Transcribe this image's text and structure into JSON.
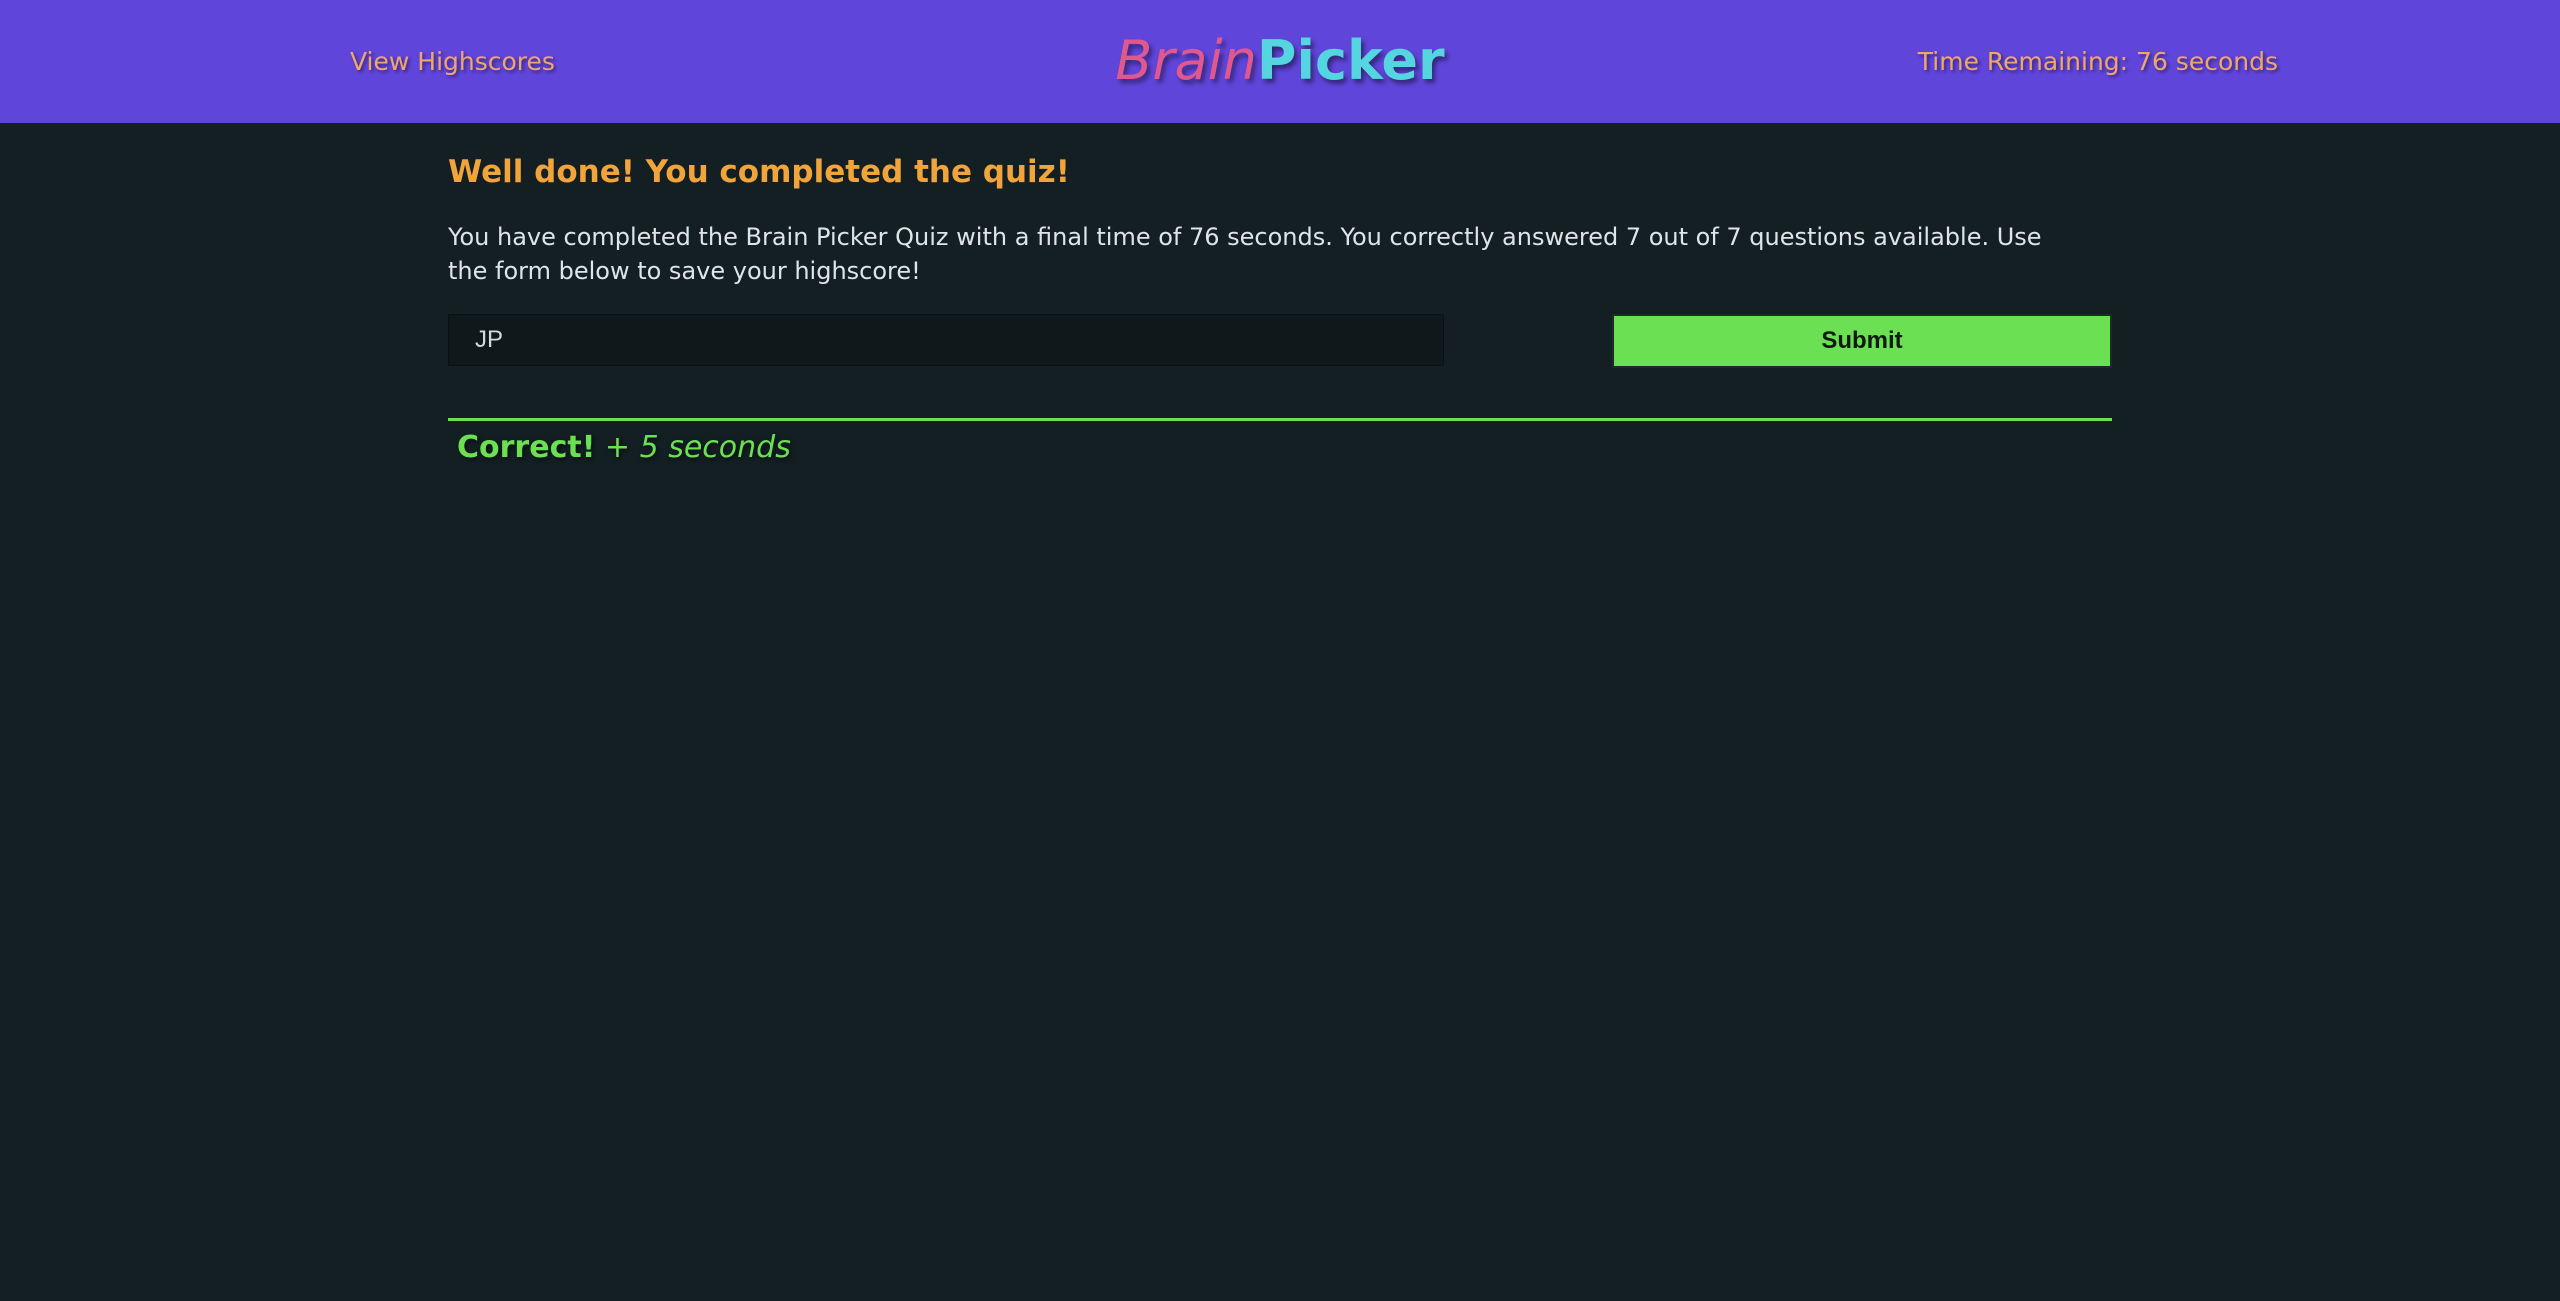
{
  "header": {
    "highscores_link": "View Highscores",
    "brand_part1": "Brain",
    "brand_part2": "Picker",
    "timer_text": "Time Remaining: 76 seconds"
  },
  "result": {
    "heading": "Well done! You completed the quiz!",
    "summary": "You have completed the Brain Picker Quiz with a final time of 76 seconds. You correctly answered 7 out of 7 questions available. Use the form below to save your highscore!"
  },
  "form": {
    "initials_value": "JP",
    "submit_label": "Submit"
  },
  "feedback": {
    "status": "Correct!",
    "bonus": "+ 5 seconds"
  },
  "colors": {
    "header_bg": "#6045db",
    "page_bg": "#131f23",
    "accent_orange": "#f1a43c",
    "accent_green": "#6be053",
    "brand_pink": "#e1588e",
    "brand_cyan": "#55d5e0"
  }
}
